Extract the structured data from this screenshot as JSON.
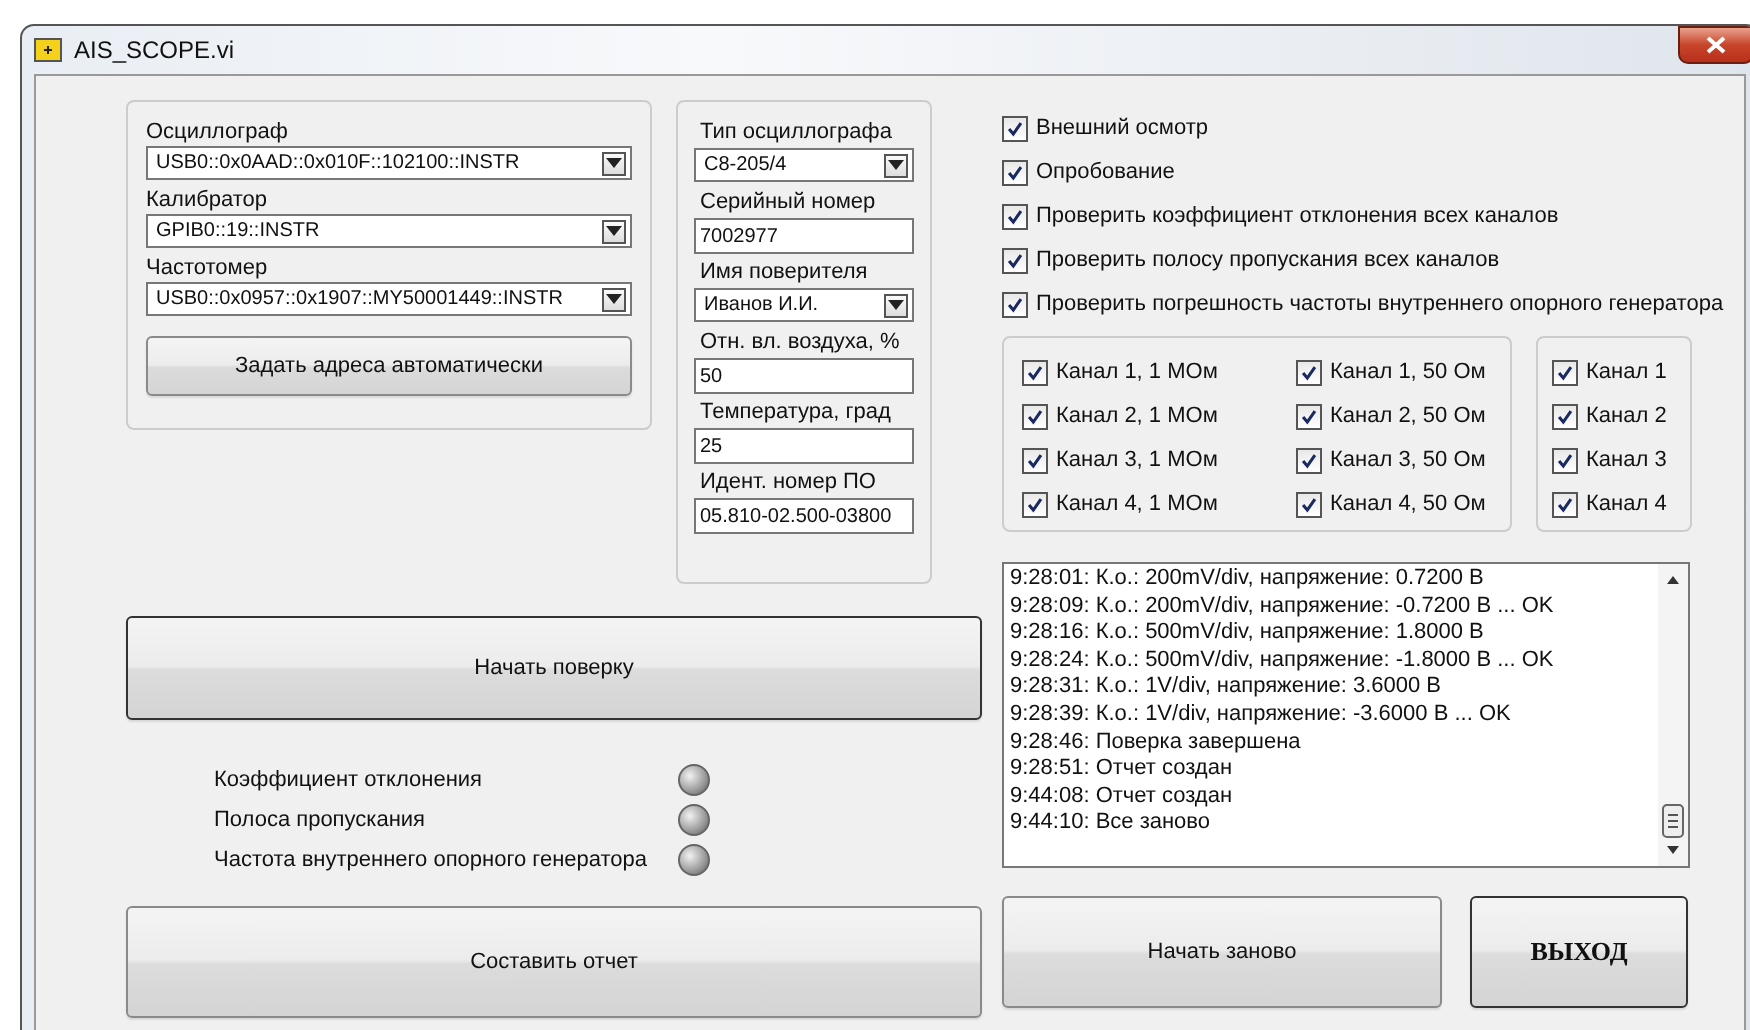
{
  "window": {
    "title": "AIS_SCOPE.vi"
  },
  "addresses": {
    "fields": [
      {
        "label": "Осциллограф",
        "value": "USB0::0x0AAD::0x010F::102100::INSTR"
      },
      {
        "label": "Калибратор",
        "value": "GPIB0::19::INSTR"
      },
      {
        "label": "Частотомер",
        "value": "USB0::0x0957::0x1907::MY50001449::INSTR"
      }
    ],
    "auto_button": "Задать адреса автоматически"
  },
  "device": {
    "fields": [
      {
        "label": "Тип осциллографа",
        "value": "С8-205/4",
        "kind": "dropdown"
      },
      {
        "label": "Серийный номер",
        "value": "7002977",
        "kind": "text"
      },
      {
        "label": "Имя поверителя",
        "value": "Иванов И.И.",
        "kind": "dropdown"
      },
      {
        "label": "Отн. вл. воздуха, %",
        "value": "50",
        "kind": "text"
      },
      {
        "label": "Температура, град",
        "value": "25",
        "kind": "text"
      },
      {
        "label": "Идент. номер ПО",
        "value": "05.810-02.500-03800",
        "kind": "text"
      }
    ]
  },
  "checks": [
    {
      "label": "Внешний осмотр",
      "checked": true
    },
    {
      "label": "Опробование",
      "checked": true
    },
    {
      "label": "Проверить коэффициент отклонения всех каналов",
      "checked": true
    },
    {
      "label": "Проверить полосу пропускания всех каналов",
      "checked": true
    },
    {
      "label": "Проверить погрешность частоты внутреннего опорного генератора",
      "checked": true
    }
  ],
  "channel_checks": [
    {
      "label": "Канал 1, 1 МОм",
      "checked": true
    },
    {
      "label": "Канал 1, 50 Ом",
      "checked": true
    },
    {
      "label": "Канал 2, 1 МОм",
      "checked": true
    },
    {
      "label": "Канал 2, 50 Ом",
      "checked": true
    },
    {
      "label": "Канал 3, 1 МОм",
      "checked": true
    },
    {
      "label": "Канал 3, 50 Ом",
      "checked": true
    },
    {
      "label": "Канал 4, 1 МОм",
      "checked": true
    },
    {
      "label": "Канал 4, 50 Ом",
      "checked": true
    }
  ],
  "frequency_channels": [
    {
      "label": "Канал 1",
      "checked": true
    },
    {
      "label": "Канал 2",
      "checked": true
    },
    {
      "label": "Канал 3",
      "checked": true
    },
    {
      "label": "Канал 4",
      "checked": true
    }
  ],
  "start_button": "Начать поверку",
  "indicators": [
    {
      "label": "Коэффициент отклонения",
      "on": false
    },
    {
      "label": "Полоса пропускания",
      "on": false
    },
    {
      "label": "Частота внутреннего опорного генератора",
      "on": false
    }
  ],
  "log": {
    "lines": [
      "9:28:01: К.о.: 200mV/div, напряжение: 0.7200 В",
      "9:28:09: К.о.: 200mV/div, напряжение: -0.7200 В ... OK",
      "9:28:16: К.о.: 500mV/div, напряжение: 1.8000 В",
      "9:28:24: К.о.: 500mV/div, напряжение: -1.8000 В ... OK",
      "9:28:31: К.о.: 1V/div, напряжение: 3.6000 В",
      "9:28:39: К.о.: 1V/div, напряжение: -3.6000 В ... OK",
      "9:28:46: Поверка завершена",
      "9:28:51: Отчет создан",
      "9:44:08: Отчет создан",
      "9:44:10: Все заново"
    ]
  },
  "buttons": {
    "report": "Составить отчет",
    "restart": "Начать заново",
    "exit": "ВЫХОД"
  }
}
